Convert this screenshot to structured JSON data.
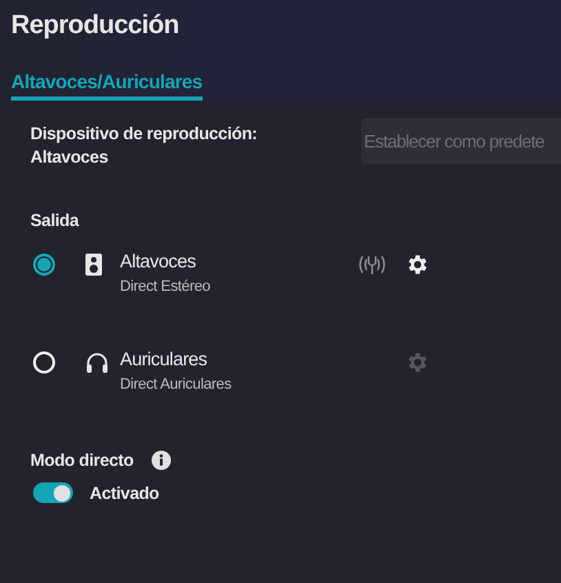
{
  "header": {
    "title": "Reproducción"
  },
  "tabs": [
    {
      "label": "Altavoces/Auriculares",
      "selected": true
    }
  ],
  "playback_device": {
    "label": "Dispositivo de reproducción:",
    "value": "Altavoces",
    "set_default_button": "Establecer como predete"
  },
  "output": {
    "heading": "Salida",
    "devices": [
      {
        "kind": "speaker",
        "name": "Altavoces",
        "mode": "Direct Estéreo",
        "selected": true,
        "direct_indicator": true,
        "settings_disabled": false
      },
      {
        "kind": "headphones",
        "name": "Auriculares",
        "mode": "Direct Auriculares",
        "selected": false,
        "direct_indicator": false,
        "settings_disabled": true
      }
    ]
  },
  "direct_mode": {
    "label": "Modo directo",
    "on": true,
    "state_label": "Activado"
  }
}
